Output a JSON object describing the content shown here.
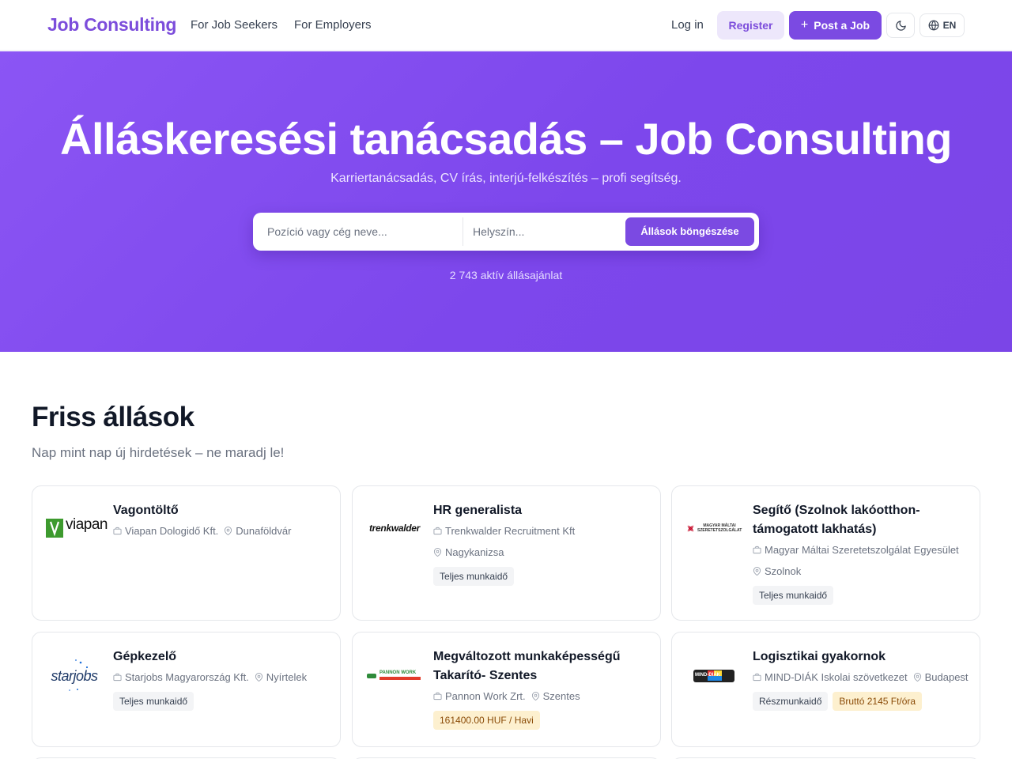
{
  "header": {
    "brand": "Job Consulting",
    "nav": [
      "For Job Seekers",
      "For Employers"
    ],
    "login": "Log in",
    "register": "Register",
    "post_job": "Post a Job",
    "lang": "EN",
    "theme_icon": "moon-icon",
    "lang_icon": "globe-icon"
  },
  "hero": {
    "title": "Álláskeresési tanácsadás – Job Consulting",
    "subtitle": "Karriertanácsadás, CV írás, interjú-felkészítés – profi segítség.",
    "search_placeholder": "Pozíció vagy cég neve...",
    "location_placeholder": "Helyszín...",
    "search_button": "Állások böngészése",
    "job_count": "2 743 aktív állásajánlat"
  },
  "section": {
    "title": "Friss állások",
    "subtitle": "Nap mint nap új hirdetések – ne maradj le!"
  },
  "colors": {
    "brand": "#7c4ddb",
    "hero_gradient_start": "#8b55f4",
    "hero_gradient_end": "#7b45e7",
    "salary_bg": "#fdf0cf"
  },
  "jobs": [
    {
      "title": "Vagontöltő",
      "company": "Viapan Dologidő Kft.",
      "location": "Dunaföldvár",
      "logo": "viapan",
      "tags": []
    },
    {
      "title": "HR generalista",
      "company": "Trenkwalder Recruitment Kft",
      "location": "Nagykanizsa",
      "logo": "trenkwalder",
      "tags": [
        "Teljes munkaidő"
      ]
    },
    {
      "title": "Segítő (Szolnok lakóotthon-támogatott lakhatás)",
      "company": "Magyar Máltai Szeretetszolgálat Egyesület",
      "location": "Szolnok",
      "logo": "MAGYAR MÁLTAI SZERETETSZOLGÁLAT",
      "tags": [
        "Teljes munkaidő"
      ]
    },
    {
      "title": "Gépkezelő",
      "company": "Starjobs Magyarország Kft.",
      "location": "Nyírtelek",
      "logo": "starjobs",
      "tags": [
        "Teljes munkaidő"
      ]
    },
    {
      "title": "Megváltozott munkaképességű Takarító- Szentes",
      "company": "Pannon Work Zrt.",
      "location": "Szentes",
      "logo": "PANNON WORK",
      "tags": [],
      "salary": "161400.00 HUF / Havi"
    },
    {
      "title": "Logisztikai gyakornok",
      "company": "MIND-DIÁK Iskolai szövetkezet",
      "location": "Budapest",
      "logo": "MIND-DIÁK",
      "tags": [
        "Részmunkaidő"
      ],
      "salary": "Bruttó 2145 Ft/óra"
    }
  ]
}
